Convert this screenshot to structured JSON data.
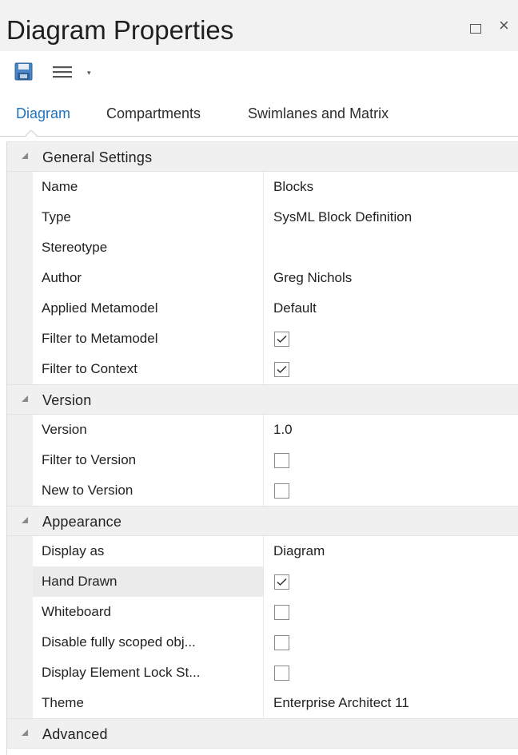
{
  "window": {
    "title": "Diagram Properties",
    "maximize_glyph": "□",
    "close_glyph": "×"
  },
  "toolbar": {
    "save_icon": "save-icon",
    "menu_icon": "hamburger-menu-icon",
    "dropdown_glyph": "▾"
  },
  "tabs": [
    {
      "label": "Diagram",
      "active": true
    },
    {
      "label": "Compartments",
      "active": false
    },
    {
      "label": "Swimlanes and Matrix",
      "active": false
    }
  ],
  "colors": {
    "active_tab": "#1e73be",
    "category_bg": "#f0f0f0",
    "highlight_row": "#ebebeb"
  },
  "sections": [
    {
      "label": "General Settings",
      "rows": [
        {
          "name": "Name",
          "value": "Blocks"
        },
        {
          "name": "Type",
          "value": "SysML Block Definition"
        },
        {
          "name": "Stereotype",
          "value": ""
        },
        {
          "name": "Author",
          "value": "Greg Nichols"
        },
        {
          "name": "Applied Metamodel",
          "value": "Default"
        },
        {
          "name": "Filter to Metamodel",
          "checked": true
        },
        {
          "name": "Filter to Context",
          "checked": true
        }
      ]
    },
    {
      "label": "Version",
      "rows": [
        {
          "name": "Version",
          "value": "1.0"
        },
        {
          "name": "Filter to Version",
          "checked": false
        },
        {
          "name": "New to Version",
          "checked": false
        }
      ]
    },
    {
      "label": "Appearance",
      "rows": [
        {
          "name": "Display as",
          "value": "Diagram"
        },
        {
          "name": "Hand Drawn",
          "checked": true,
          "highlighted": true
        },
        {
          "name": "Whiteboard",
          "checked": false
        },
        {
          "name": "Disable fully scoped obj...",
          "checked": false
        },
        {
          "name": "Display Element Lock St...",
          "checked": false
        },
        {
          "name": "Theme",
          "value": "Enterprise Architect 11"
        }
      ]
    },
    {
      "label": "Advanced",
      "rows": []
    }
  ]
}
